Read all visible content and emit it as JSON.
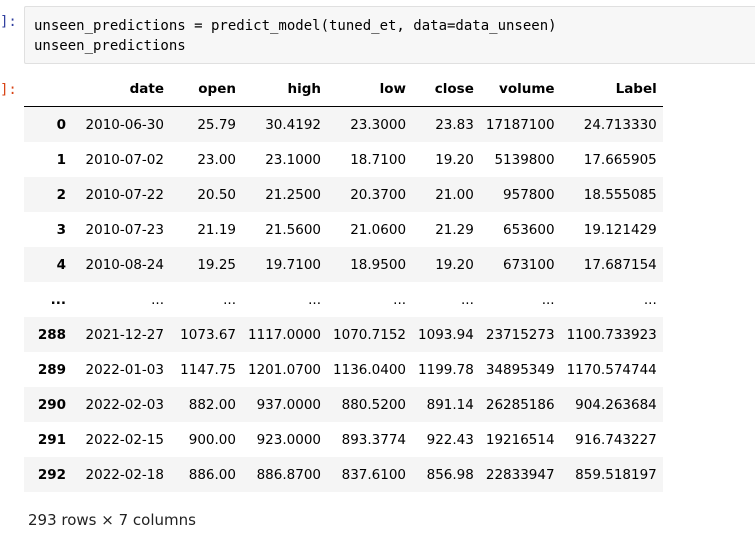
{
  "cell": {
    "in_prompt": "]:",
    "out_prompt": "]:",
    "code_lines": [
      "unseen_predictions = predict_model(tuned_et, data=data_unseen)",
      "unseen_predictions"
    ]
  },
  "table": {
    "columns": [
      "",
      "date",
      "open",
      "high",
      "low",
      "close",
      "volume",
      "Label"
    ],
    "rows": [
      [
        "0",
        "2010-06-30",
        "25.79",
        "30.4192",
        "23.3000",
        "23.83",
        "17187100",
        "24.713330"
      ],
      [
        "1",
        "2010-07-02",
        "23.00",
        "23.1000",
        "18.7100",
        "19.20",
        "5139800",
        "17.665905"
      ],
      [
        "2",
        "2010-07-22",
        "20.50",
        "21.2500",
        "20.3700",
        "21.00",
        "957800",
        "18.555085"
      ],
      [
        "3",
        "2010-07-23",
        "21.19",
        "21.5600",
        "21.0600",
        "21.29",
        "653600",
        "19.121429"
      ],
      [
        "4",
        "2010-08-24",
        "19.25",
        "19.7100",
        "18.9500",
        "19.20",
        "673100",
        "17.687154"
      ],
      [
        "...",
        "...",
        "...",
        "...",
        "...",
        "...",
        "...",
        "..."
      ],
      [
        "288",
        "2021-12-27",
        "1073.67",
        "1117.0000",
        "1070.7152",
        "1093.94",
        "23715273",
        "1100.733923"
      ],
      [
        "289",
        "2022-01-03",
        "1147.75",
        "1201.0700",
        "1136.0400",
        "1199.78",
        "34895349",
        "1170.574744"
      ],
      [
        "290",
        "2022-02-03",
        "882.00",
        "937.0000",
        "880.5200",
        "891.14",
        "26285186",
        "904.263684"
      ],
      [
        "291",
        "2022-02-15",
        "900.00",
        "923.0000",
        "893.3774",
        "922.43",
        "19216514",
        "916.743227"
      ],
      [
        "292",
        "2022-02-18",
        "886.00",
        "886.8700",
        "837.6100",
        "856.98",
        "22833947",
        "859.518197"
      ]
    ]
  },
  "summary": "293 rows × 7 columns"
}
